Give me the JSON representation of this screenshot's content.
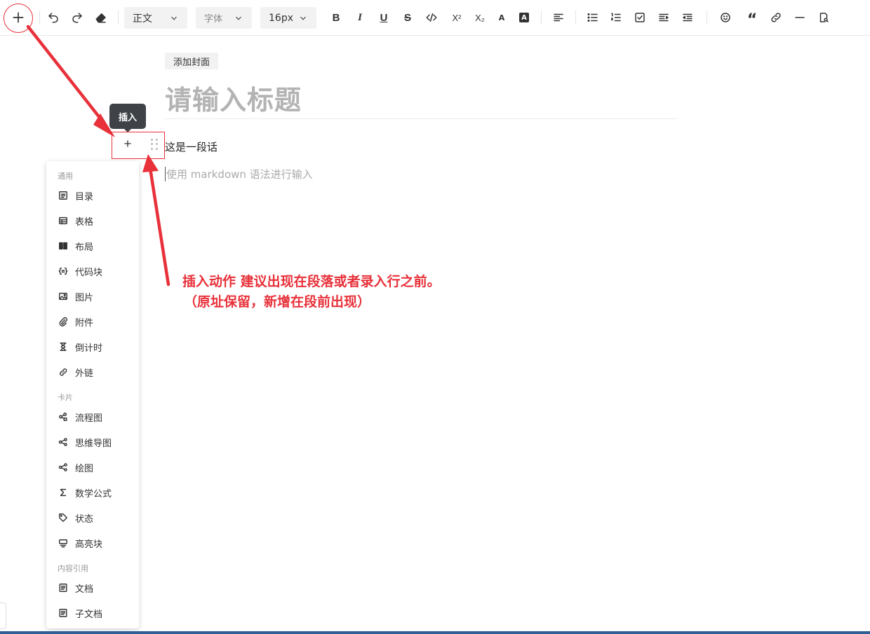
{
  "toolbar": {
    "paragraph_style": "正文",
    "font_family": "字体",
    "font_size": "16px",
    "bold": "B",
    "italic": "I",
    "underline": "U",
    "strike": "S",
    "superscript": "X²",
    "subscript": "X₂",
    "font_color": "A",
    "highlight": "A"
  },
  "editor": {
    "add_cover": "添加封面",
    "title_placeholder": "请输入标题",
    "paragraph": "这是一段话",
    "input_placeholder": "使用 markdown 语法进行输入"
  },
  "tooltip": {
    "label": "插入"
  },
  "insert_menu": {
    "sections": [
      {
        "label": "通用",
        "items": [
          {
            "label": "目录",
            "icon": "toc-icon"
          },
          {
            "label": "表格",
            "icon": "table-icon"
          },
          {
            "label": "布局",
            "icon": "layout-icon"
          },
          {
            "label": "代码块",
            "icon": "code-block-icon"
          },
          {
            "label": "图片",
            "icon": "image-icon"
          },
          {
            "label": "附件",
            "icon": "attachment-icon"
          },
          {
            "label": "倒计时",
            "icon": "hourglass-icon"
          },
          {
            "label": "外链",
            "icon": "link-icon"
          }
        ]
      },
      {
        "label": "卡片",
        "items": [
          {
            "label": "流程图",
            "icon": "flowchart-icon"
          },
          {
            "label": "思维导图",
            "icon": "mindmap-icon"
          },
          {
            "label": "绘图",
            "icon": "drawing-icon"
          },
          {
            "label": "数学公式",
            "icon": "sigma-icon"
          },
          {
            "label": "状态",
            "icon": "tag-icon"
          },
          {
            "label": "高亮块",
            "icon": "highlight-block-icon"
          }
        ]
      },
      {
        "label": "内容引用",
        "items": [
          {
            "label": "文档",
            "icon": "document-icon"
          },
          {
            "label": "子文档",
            "icon": "subdocument-icon"
          }
        ]
      }
    ]
  },
  "annotation": {
    "line1": "插入动作 建议出现在段落或者录入行之前。",
    "line2": "（原址保留，新增在段前出现）",
    "color": "#e8313a"
  }
}
